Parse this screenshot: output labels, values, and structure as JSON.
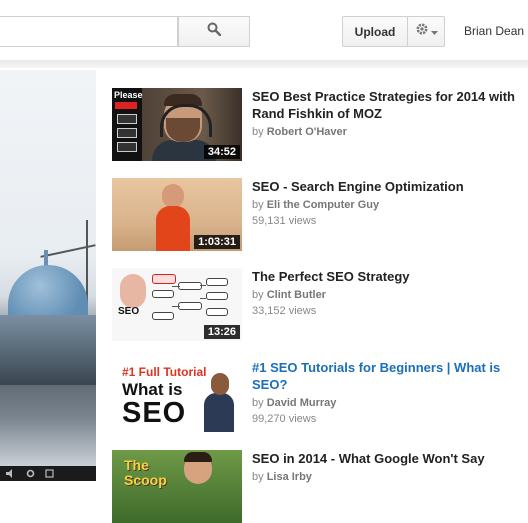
{
  "header": {
    "search_placeholder": "",
    "upload_label": "Upload",
    "username": "Brian Dean"
  },
  "suggestions": [
    {
      "title": "SEO Best Practice Strategies for 2014 with Rand Fishkin of MOZ",
      "by_prefix": "by",
      "author": "Robert O'Haver",
      "views": "",
      "duration": "34:52",
      "thumb_text": "Please"
    },
    {
      "title": "SEO - Search Engine Optimization",
      "by_prefix": "by",
      "author": "Eli the Computer Guy",
      "views": "59,131 views",
      "duration": "1:03:31"
    },
    {
      "title": "The Perfect SEO Strategy",
      "by_prefix": "by",
      "author": "Clint Butler",
      "views": "33,152 views",
      "duration": "13:26",
      "thumb_text": "SEO"
    },
    {
      "title": "#1 SEO Tutorials for Beginners | What is SEO?",
      "by_prefix": "by",
      "author": "David Murray",
      "views": "99,270 views",
      "duration": "",
      "thumb_line1": "#1 Full Tutorial",
      "thumb_line2": "What is",
      "thumb_line3": "SEO"
    },
    {
      "title": "SEO in 2014 - What Google Won't Say",
      "by_prefix": "by",
      "author": "Lisa Irby",
      "views": "",
      "duration": "",
      "thumb_line1": "The",
      "thumb_line2": "Scoop"
    }
  ],
  "colors": {
    "link_title": "#1b6fb8",
    "title": "#222222",
    "meta": "#888888"
  },
  "icons": {
    "search": "search-icon",
    "settings": "gear-icon",
    "dropdown": "caret-down-icon"
  }
}
